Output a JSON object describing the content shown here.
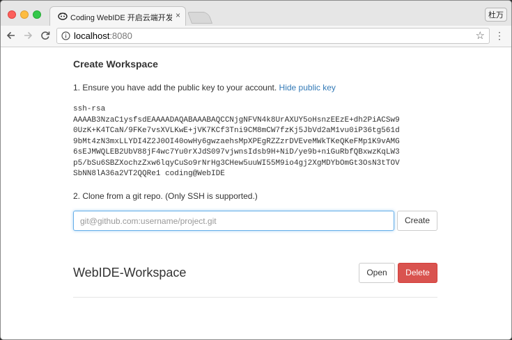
{
  "browser": {
    "tab_title": "Coding WebIDE 开启云端开发模式",
    "tab_close": "×",
    "profile_label": "杜万",
    "url_host": "localhost",
    "url_port": ":8080",
    "back_icon": "back-arrow-icon",
    "forward_icon": "forward-arrow-icon",
    "reload_icon": "reload-icon",
    "info_icon": "info-circle-icon",
    "star_icon": "star-icon",
    "menu_icon": "vertical-dots-icon"
  },
  "page": {
    "heading": "Create Workspace",
    "step1_text": "1. Ensure you have add the public key to your account.",
    "step1_link": "Hide public key",
    "ssh_key": "ssh-rsa\nAAAAB3NzaC1ysfsdEAAAADAQABAAABAQCCNjgNFVN4k8UrAXUY5oHsnzEEzE+dh2PiACSw9\n0UzK+K4TCaN/9FKe7vsXVLKwE+jVK7KCf3Tni9CM8mCW7fzKj5JbVd2aM1vu0iP36tg561d\n9bMt4zN3mxLLYDI4Z2J0OI40owHy6gwzaehsMpXPEgRZZzrDVEveMWkTKeQKeFMp1K9vAMG\n6sEJMWQLEB2UbV88jF4wc7Yu0rXJdS097vjwnsIdsb9H+NiD/ye9b+niGuRbfQBxwzKqLW3\np5/bSu6SBZXochzZxw6lqyCuSo9rNrHg3CHew5uuWI55M9io4gj2XgMDYbOmGt3OsN3tTOV\nSbNN8lA36a2VT2QQRe1 coding@WebIDE",
    "step2_text": "2. Clone from a git repo. (Only SSH is supported.)",
    "repo_placeholder": "git@github.com:username/project.git",
    "repo_value": "",
    "create_button": "Create",
    "workspace_name": "WebIDE-Workspace",
    "open_button": "Open",
    "delete_button": "Delete"
  },
  "colors": {
    "link": "#337ab7",
    "danger": "#d9534f",
    "focus": "#66afe9"
  }
}
